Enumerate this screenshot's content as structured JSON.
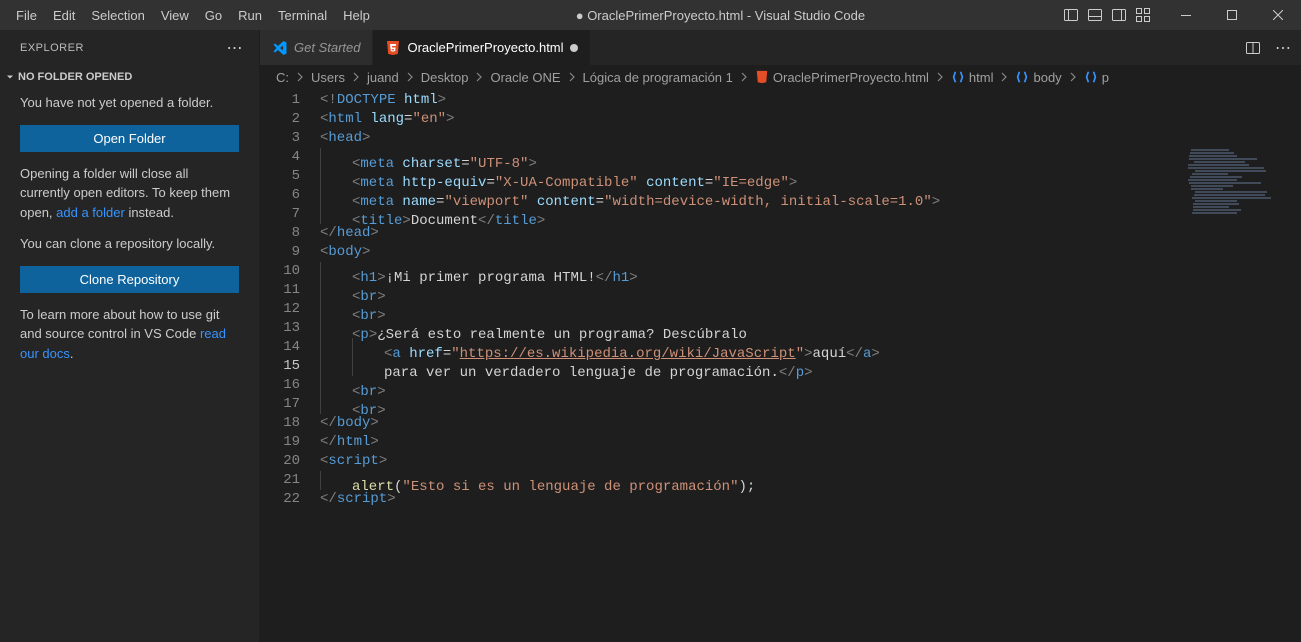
{
  "window": {
    "title": "● OraclePrimerProyecto.html - Visual Studio Code"
  },
  "menu": {
    "items": [
      "File",
      "Edit",
      "Selection",
      "View",
      "Go",
      "Run",
      "Terminal",
      "Help"
    ]
  },
  "sidebar": {
    "title": "EXPLORER",
    "section_title": "NO FOLDER OPENED",
    "no_folder_msg": "You have not yet opened a folder.",
    "open_folder_btn": "Open Folder",
    "open_folder_hint_pre": "Opening a folder will close all currently open editors. To keep them open, ",
    "add_folder_link": "add a folder",
    "open_folder_hint_post": " instead.",
    "clone_msg": "You can clone a repository locally.",
    "clone_btn": "Clone Repository",
    "docs_msg_pre": "To learn more about how to use git and source control in VS Code ",
    "docs_link": "read our docs",
    "docs_msg_post": "."
  },
  "tabs": {
    "items": [
      {
        "label": "Get Started",
        "active": false,
        "icon": "vscode"
      },
      {
        "label": "OraclePrimerProyecto.html",
        "active": true,
        "icon": "html",
        "dirty": true
      }
    ]
  },
  "breadcrumbs": {
    "path": [
      "C:",
      "Users",
      "juand",
      "Desktop",
      "Oracle ONE",
      "Lógica de programación 1"
    ],
    "file": "OraclePrimerProyecto.html",
    "symbols": [
      "html",
      "body",
      "p"
    ]
  },
  "editor": {
    "current_line": 15,
    "lines": [
      {
        "n": 1,
        "tokens": [
          [
            "<!",
            "gray"
          ],
          [
            "DOCTYPE",
            "blue"
          ],
          [
            " ",
            "text"
          ],
          [
            "html",
            "attr"
          ],
          [
            ">",
            "gray"
          ]
        ]
      },
      {
        "n": 2,
        "tokens": [
          [
            "<",
            "gray"
          ],
          [
            "html",
            "blue"
          ],
          [
            " ",
            "text"
          ],
          [
            "lang",
            "attr"
          ],
          [
            "=",
            "text"
          ],
          [
            "\"en\"",
            "str"
          ],
          [
            ">",
            "gray"
          ]
        ]
      },
      {
        "n": 3,
        "tokens": [
          [
            "<",
            "gray"
          ],
          [
            "head",
            "blue"
          ],
          [
            ">",
            "gray"
          ]
        ]
      },
      {
        "n": 4,
        "indent": 1,
        "tokens": [
          [
            "<",
            "gray"
          ],
          [
            "meta",
            "blue"
          ],
          [
            " ",
            "text"
          ],
          [
            "charset",
            "attr"
          ],
          [
            "=",
            "text"
          ],
          [
            "\"UTF-8\"",
            "str"
          ],
          [
            ">",
            "gray"
          ]
        ]
      },
      {
        "n": 5,
        "indent": 1,
        "tokens": [
          [
            "<",
            "gray"
          ],
          [
            "meta",
            "blue"
          ],
          [
            " ",
            "text"
          ],
          [
            "http-equiv",
            "attr"
          ],
          [
            "=",
            "text"
          ],
          [
            "\"X-UA-Compatible\"",
            "str"
          ],
          [
            " ",
            "text"
          ],
          [
            "content",
            "attr"
          ],
          [
            "=",
            "text"
          ],
          [
            "\"IE=edge\"",
            "str"
          ],
          [
            ">",
            "gray"
          ]
        ]
      },
      {
        "n": 6,
        "indent": 1,
        "tokens": [
          [
            "<",
            "gray"
          ],
          [
            "meta",
            "blue"
          ],
          [
            " ",
            "text"
          ],
          [
            "name",
            "attr"
          ],
          [
            "=",
            "text"
          ],
          [
            "\"viewport\"",
            "str"
          ],
          [
            " ",
            "text"
          ],
          [
            "content",
            "attr"
          ],
          [
            "=",
            "text"
          ],
          [
            "\"width=device-width, initial-scale=1.0\"",
            "str"
          ],
          [
            ">",
            "gray"
          ]
        ]
      },
      {
        "n": 7,
        "indent": 1,
        "tokens": [
          [
            "<",
            "gray"
          ],
          [
            "title",
            "blue"
          ],
          [
            ">",
            "gray"
          ],
          [
            "Document",
            "text"
          ],
          [
            "</",
            "gray"
          ],
          [
            "title",
            "blue"
          ],
          [
            ">",
            "gray"
          ]
        ]
      },
      {
        "n": 8,
        "tokens": [
          [
            "</",
            "gray"
          ],
          [
            "head",
            "blue"
          ],
          [
            ">",
            "gray"
          ]
        ]
      },
      {
        "n": 9,
        "tokens": [
          [
            "<",
            "gray"
          ],
          [
            "body",
            "blue"
          ],
          [
            ">",
            "gray"
          ]
        ]
      },
      {
        "n": 10,
        "indent": 1,
        "tokens": [
          [
            "<",
            "gray"
          ],
          [
            "h1",
            "blue"
          ],
          [
            ">",
            "gray"
          ],
          [
            "¡Mi primer programa HTML!",
            "text"
          ],
          [
            "</",
            "gray"
          ],
          [
            "h1",
            "blue"
          ],
          [
            ">",
            "gray"
          ]
        ]
      },
      {
        "n": 11,
        "indent": 1,
        "tokens": [
          [
            "<",
            "gray"
          ],
          [
            "br",
            "blue"
          ],
          [
            ">",
            "gray"
          ]
        ]
      },
      {
        "n": 12,
        "indent": 1,
        "tokens": [
          [
            "<",
            "gray"
          ],
          [
            "br",
            "blue"
          ],
          [
            ">",
            "gray"
          ]
        ]
      },
      {
        "n": 13,
        "indent": 1,
        "tokens": [
          [
            "<",
            "gray"
          ],
          [
            "p",
            "blue"
          ],
          [
            ">",
            "gray"
          ],
          [
            "¿Será esto realmente un programa? Descúbralo",
            "text"
          ]
        ]
      },
      {
        "n": 14,
        "indent": 2,
        "tokens": [
          [
            "<",
            "gray"
          ],
          [
            "a",
            "blue"
          ],
          [
            " ",
            "text"
          ],
          [
            "href",
            "attr"
          ],
          [
            "=",
            "text"
          ],
          [
            "\"",
            "str"
          ],
          [
            "https://es.wikipedia.org/wiki/JavaScript",
            "link"
          ],
          [
            "\"",
            "str"
          ],
          [
            ">",
            "gray"
          ],
          [
            "aquí",
            "text"
          ],
          [
            "</",
            "gray"
          ],
          [
            "a",
            "blue"
          ],
          [
            ">",
            "gray"
          ]
        ]
      },
      {
        "n": 15,
        "indent": 2,
        "tokens": [
          [
            "para ver un verdadero lenguaje de programación.",
            "text"
          ],
          [
            "</",
            "gray"
          ],
          [
            "p",
            "blue"
          ],
          [
            ">",
            "gray"
          ]
        ]
      },
      {
        "n": 16,
        "indent": 1,
        "tokens": [
          [
            "<",
            "gray"
          ],
          [
            "br",
            "blue"
          ],
          [
            ">",
            "gray"
          ]
        ]
      },
      {
        "n": 17,
        "indent": 1,
        "tokens": [
          [
            "<",
            "gray"
          ],
          [
            "br",
            "blue"
          ],
          [
            ">",
            "gray"
          ]
        ]
      },
      {
        "n": 18,
        "tokens": [
          [
            "</",
            "gray"
          ],
          [
            "body",
            "blue"
          ],
          [
            ">",
            "gray"
          ]
        ]
      },
      {
        "n": 19,
        "tokens": [
          [
            "</",
            "gray"
          ],
          [
            "html",
            "blue"
          ],
          [
            ">",
            "gray"
          ]
        ]
      },
      {
        "n": 20,
        "tokens": [
          [
            "<",
            "gray"
          ],
          [
            "script",
            "blue"
          ],
          [
            ">",
            "gray"
          ]
        ]
      },
      {
        "n": 21,
        "indent": 1,
        "tokens": [
          [
            "alert",
            "func"
          ],
          [
            "(",
            "text"
          ],
          [
            "\"Esto si es un lenguaje de programación\"",
            "str"
          ],
          [
            ")",
            "text"
          ],
          [
            ";",
            "text"
          ]
        ]
      },
      {
        "n": 22,
        "tokens": [
          [
            "</",
            "gray"
          ],
          [
            "script",
            "blue"
          ],
          [
            ">",
            "gray"
          ]
        ]
      }
    ]
  }
}
